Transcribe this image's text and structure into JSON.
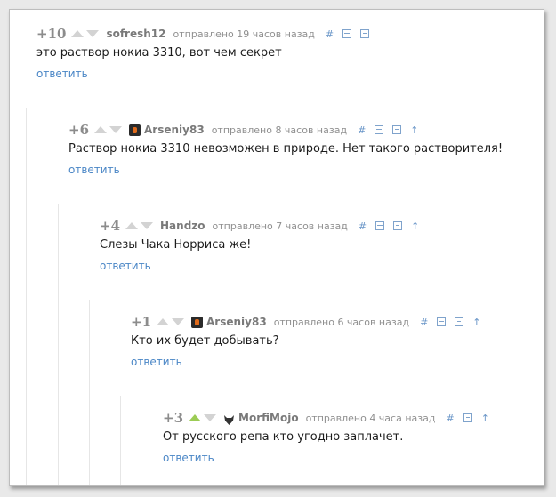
{
  "colors": {
    "link": "#4a86c6",
    "upvote_active": "#9ccc55",
    "muted": "#8c8c8c"
  },
  "comments": [
    {
      "rating": "+10",
      "username": "sofresh12",
      "time": "отправлено 19 часов назад",
      "hash": "#",
      "text": "это раствор нокиа 3310, вот чем секрет",
      "reply": "ответить"
    },
    {
      "rating": "+6",
      "username": "Arseniy83",
      "time": "отправлено 8 часов назад",
      "hash": "#",
      "up_arrow": "↑",
      "text": "Раствор нокиа 3310 невозможен в природе. Нет такого растворителя!",
      "reply": "ответить"
    },
    {
      "rating": "+4",
      "username": "Handzo",
      "time": "отправлено 7 часов назад",
      "hash": "#",
      "up_arrow": "↑",
      "text": "Слезы Чака Норриса же!",
      "reply": "ответить"
    },
    {
      "rating": "+1",
      "username": "Arseniy83",
      "time": "отправлено 6 часов назад",
      "hash": "#",
      "up_arrow": "↑",
      "text": "Кто их будет добывать?",
      "reply": "ответить"
    },
    {
      "rating": "+3",
      "username": "MorfiMojo",
      "time": "отправлено 4 часа назад",
      "hash": "#",
      "up_arrow": "↑",
      "text": "От русского репа кто угодно заплачет.",
      "reply": "ответить"
    }
  ]
}
